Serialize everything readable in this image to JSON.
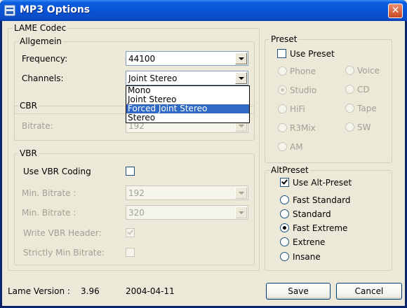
{
  "window": {
    "title": "MP3 Options",
    "close_label": "✕"
  },
  "lame_codec": {
    "title": "LAME Codec",
    "allgemein": {
      "title": "Allgemein",
      "frequency_label": "Frequency:",
      "frequency_value": "44100",
      "channels_label": "Channels:",
      "channels_value": "Joint Stereo",
      "channels_options": [
        "Mono",
        "Joint Stereo",
        "Forced Joint Stereo",
        "Stereo"
      ],
      "channels_highlighted": "Forced Joint Stereo"
    },
    "cbr": {
      "title": "CBR",
      "bitrate_label": "Bitrate:",
      "bitrate_value": "192"
    },
    "vbr": {
      "title": "VBR",
      "use_vbr_label": "Use VBR Coding",
      "use_vbr_checked": false,
      "min_bitrate_label": "Min. Bitrate :",
      "min_bitrate_value": "192",
      "max_bitrate_label": "Min. Bitrate :",
      "max_bitrate_value": "320",
      "write_header_label": "Write VBR Header:",
      "write_header_checked": true,
      "strict_min_label": "Strictly Min Bitrate:",
      "strict_min_checked": false
    }
  },
  "preset": {
    "title": "Preset",
    "use_preset_label": "Use Preset",
    "use_preset_checked": false,
    "options": [
      {
        "label": "Phone",
        "checked": false
      },
      {
        "label": "Voice",
        "checked": false
      },
      {
        "label": "Studio",
        "checked": true
      },
      {
        "label": "CD",
        "checked": false
      },
      {
        "label": "HiFi",
        "checked": false
      },
      {
        "label": "Tape",
        "checked": false
      },
      {
        "label": "R3Mix",
        "checked": false
      },
      {
        "label": "SW",
        "checked": false
      },
      {
        "label": "AM",
        "checked": false
      }
    ]
  },
  "altpreset": {
    "title": "AltPreset",
    "use_alt_label": "Use Alt-Preset",
    "use_alt_checked": true,
    "options": [
      {
        "label": "Fast Standard",
        "checked": false
      },
      {
        "label": "Standard",
        "checked": false
      },
      {
        "label": "Fast Extreme",
        "checked": true
      },
      {
        "label": "Extrene",
        "checked": false
      },
      {
        "label": "Insane",
        "checked": false
      }
    ]
  },
  "footer": {
    "version_label": "Lame Version :",
    "version_value": "3.96",
    "date_value": "2004-04-11",
    "save_label": "Save",
    "cancel_label": "Cancel"
  }
}
